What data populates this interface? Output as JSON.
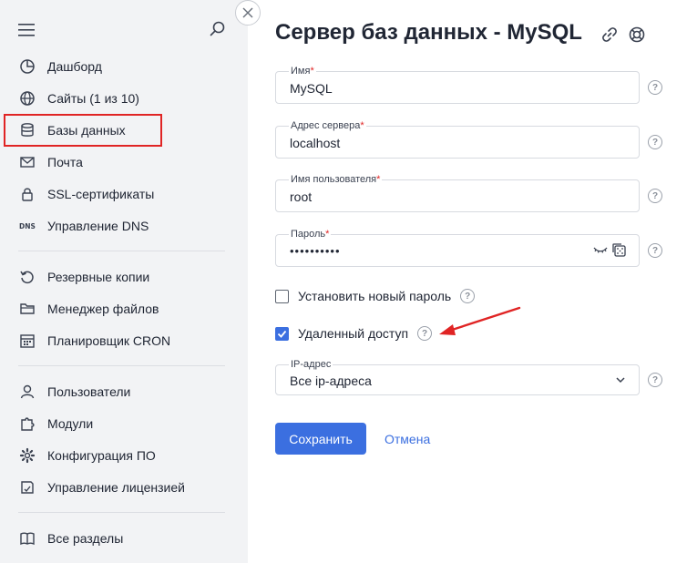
{
  "sidebar": {
    "groups": [
      [
        {
          "label": "Дашборд",
          "icon": "pie-chart-icon"
        },
        {
          "label": "Сайты (1 из 10)",
          "icon": "globe-icon"
        },
        {
          "label": "Базы данных",
          "icon": "database-icon"
        },
        {
          "label": "Почта",
          "icon": "mail-icon"
        },
        {
          "label": "SSL-сертификаты",
          "icon": "lock-icon"
        },
        {
          "label": "Управление DNS",
          "icon": "dns-icon"
        }
      ],
      [
        {
          "label": "Резервные копии",
          "icon": "backup-icon"
        },
        {
          "label": "Менеджер файлов",
          "icon": "folder-icon"
        },
        {
          "label": "Планировщик CRON",
          "icon": "calendar-icon"
        }
      ],
      [
        {
          "label": "Пользователи",
          "icon": "user-icon"
        },
        {
          "label": "Модули",
          "icon": "puzzle-icon"
        },
        {
          "label": "Конфигурация ПО",
          "icon": "gear-icon"
        },
        {
          "label": "Управление лицензией",
          "icon": "license-icon"
        }
      ],
      [
        {
          "label": "Все разделы",
          "icon": "book-icon"
        }
      ]
    ],
    "active_item": "Базы данных",
    "accent_color": "#e02424"
  },
  "page": {
    "title": "Сервер баз данных - MySQL"
  },
  "form": {
    "name": {
      "label": "Имя",
      "value": "MySQL"
    },
    "address": {
      "label": "Адрес сервера",
      "value": "localhost"
    },
    "username": {
      "label": "Имя пользователя",
      "value": "root"
    },
    "password": {
      "label": "Пароль",
      "value": "••••••••••"
    },
    "required_mark": "*",
    "help_mark": "?",
    "set_new_password": {
      "label": "Установить новый пароль",
      "checked": false
    },
    "remote_access": {
      "label": "Удаленный доступ",
      "checked": true
    },
    "ip": {
      "label": "IP-адрес",
      "value": "Все ip-адреса"
    }
  },
  "actions": {
    "save": "Сохранить",
    "cancel": "Отмена"
  },
  "colors": {
    "primary": "#3b6fe0",
    "sidebar_bg": "#f2f3f5",
    "annotation": "#e02424"
  }
}
